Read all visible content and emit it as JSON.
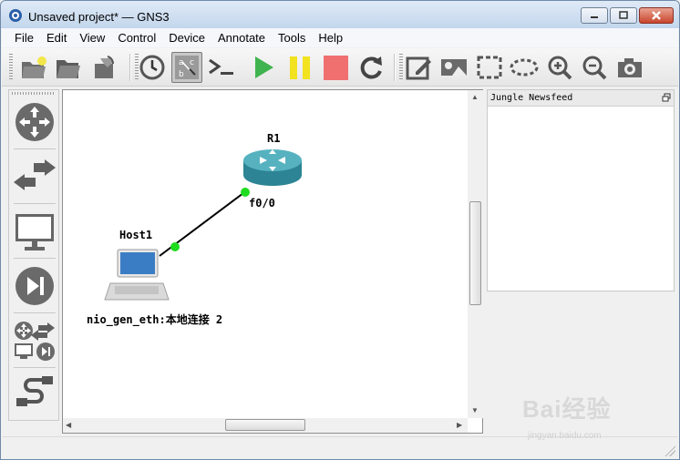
{
  "window": {
    "title": "Unsaved project* — GNS3",
    "icon": "gns3-app-icon",
    "controls": [
      "minimize",
      "maximize",
      "close"
    ]
  },
  "menu": [
    "File",
    "Edit",
    "View",
    "Control",
    "Device",
    "Annotate",
    "Tools",
    "Help"
  ],
  "toolbar": {
    "icons": [
      "new-project-icon",
      "open-project-icon",
      "save-project-icon",
      "snapshot-clock-icon",
      "show-interface-labels-icon",
      "console-icon",
      "start-icon",
      "suspend-icon",
      "stop-icon",
      "reload-icon",
      "add-note-icon",
      "insert-picture-icon",
      "draw-rectangle-icon",
      "draw-ellipse-icon",
      "zoom-in-icon",
      "zoom-out-icon",
      "screenshot-icon"
    ],
    "colors": {
      "start": "#3fb34f",
      "suspend": "#f2e21f",
      "stop": "#f07070"
    }
  },
  "sidebar": {
    "icons": [
      "routers-icon",
      "switches-icon",
      "end-devices-icon",
      "security-devices-icon",
      "all-devices-icon",
      "add-link-icon"
    ]
  },
  "topology": {
    "router": {
      "name": "R1",
      "port": "f0/0"
    },
    "host": {
      "name": "Host1",
      "interface": "nio_gen_eth:本地连接 2"
    },
    "link_status_color": "#1fdc1f"
  },
  "dock": {
    "title": "Jungle Newsfeed"
  },
  "watermark": {
    "text": "Bai经验",
    "url": "jingyan.baidu.com"
  }
}
